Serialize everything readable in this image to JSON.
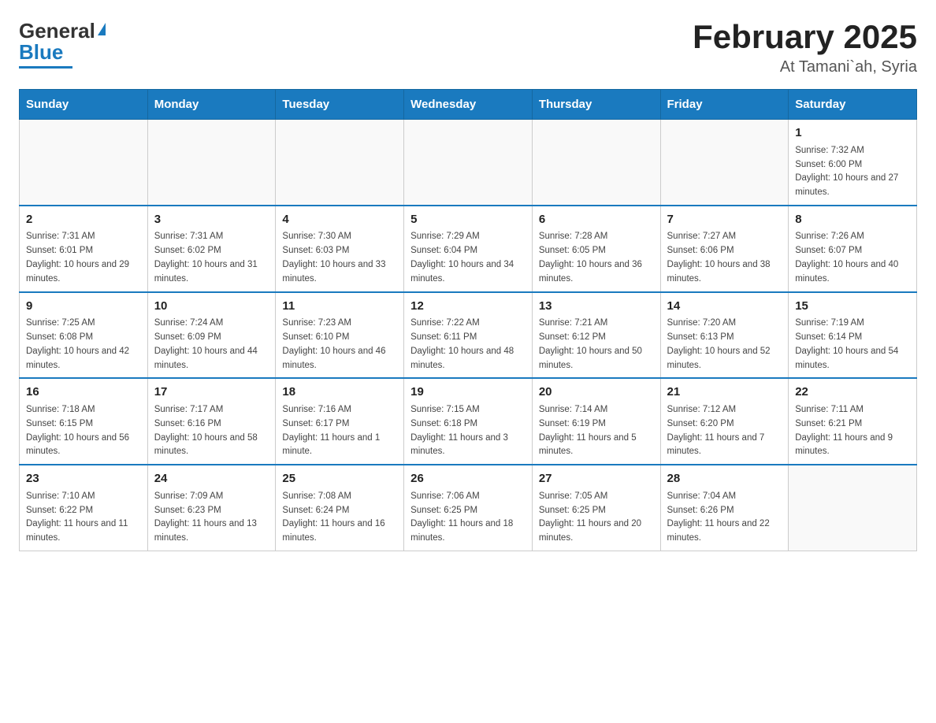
{
  "header": {
    "logo_general": "General",
    "logo_blue": "Blue",
    "title": "February 2025",
    "subtitle": "At Tamani`ah, Syria"
  },
  "days_of_week": [
    "Sunday",
    "Monday",
    "Tuesday",
    "Wednesday",
    "Thursday",
    "Friday",
    "Saturday"
  ],
  "weeks": [
    {
      "days": [
        {
          "num": "",
          "info": ""
        },
        {
          "num": "",
          "info": ""
        },
        {
          "num": "",
          "info": ""
        },
        {
          "num": "",
          "info": ""
        },
        {
          "num": "",
          "info": ""
        },
        {
          "num": "",
          "info": ""
        },
        {
          "num": "1",
          "info": "Sunrise: 7:32 AM\nSunset: 6:00 PM\nDaylight: 10 hours and 27 minutes."
        }
      ]
    },
    {
      "days": [
        {
          "num": "2",
          "info": "Sunrise: 7:31 AM\nSunset: 6:01 PM\nDaylight: 10 hours and 29 minutes."
        },
        {
          "num": "3",
          "info": "Sunrise: 7:31 AM\nSunset: 6:02 PM\nDaylight: 10 hours and 31 minutes."
        },
        {
          "num": "4",
          "info": "Sunrise: 7:30 AM\nSunset: 6:03 PM\nDaylight: 10 hours and 33 minutes."
        },
        {
          "num": "5",
          "info": "Sunrise: 7:29 AM\nSunset: 6:04 PM\nDaylight: 10 hours and 34 minutes."
        },
        {
          "num": "6",
          "info": "Sunrise: 7:28 AM\nSunset: 6:05 PM\nDaylight: 10 hours and 36 minutes."
        },
        {
          "num": "7",
          "info": "Sunrise: 7:27 AM\nSunset: 6:06 PM\nDaylight: 10 hours and 38 minutes."
        },
        {
          "num": "8",
          "info": "Sunrise: 7:26 AM\nSunset: 6:07 PM\nDaylight: 10 hours and 40 minutes."
        }
      ]
    },
    {
      "days": [
        {
          "num": "9",
          "info": "Sunrise: 7:25 AM\nSunset: 6:08 PM\nDaylight: 10 hours and 42 minutes."
        },
        {
          "num": "10",
          "info": "Sunrise: 7:24 AM\nSunset: 6:09 PM\nDaylight: 10 hours and 44 minutes."
        },
        {
          "num": "11",
          "info": "Sunrise: 7:23 AM\nSunset: 6:10 PM\nDaylight: 10 hours and 46 minutes."
        },
        {
          "num": "12",
          "info": "Sunrise: 7:22 AM\nSunset: 6:11 PM\nDaylight: 10 hours and 48 minutes."
        },
        {
          "num": "13",
          "info": "Sunrise: 7:21 AM\nSunset: 6:12 PM\nDaylight: 10 hours and 50 minutes."
        },
        {
          "num": "14",
          "info": "Sunrise: 7:20 AM\nSunset: 6:13 PM\nDaylight: 10 hours and 52 minutes."
        },
        {
          "num": "15",
          "info": "Sunrise: 7:19 AM\nSunset: 6:14 PM\nDaylight: 10 hours and 54 minutes."
        }
      ]
    },
    {
      "days": [
        {
          "num": "16",
          "info": "Sunrise: 7:18 AM\nSunset: 6:15 PM\nDaylight: 10 hours and 56 minutes."
        },
        {
          "num": "17",
          "info": "Sunrise: 7:17 AM\nSunset: 6:16 PM\nDaylight: 10 hours and 58 minutes."
        },
        {
          "num": "18",
          "info": "Sunrise: 7:16 AM\nSunset: 6:17 PM\nDaylight: 11 hours and 1 minute."
        },
        {
          "num": "19",
          "info": "Sunrise: 7:15 AM\nSunset: 6:18 PM\nDaylight: 11 hours and 3 minutes."
        },
        {
          "num": "20",
          "info": "Sunrise: 7:14 AM\nSunset: 6:19 PM\nDaylight: 11 hours and 5 minutes."
        },
        {
          "num": "21",
          "info": "Sunrise: 7:12 AM\nSunset: 6:20 PM\nDaylight: 11 hours and 7 minutes."
        },
        {
          "num": "22",
          "info": "Sunrise: 7:11 AM\nSunset: 6:21 PM\nDaylight: 11 hours and 9 minutes."
        }
      ]
    },
    {
      "days": [
        {
          "num": "23",
          "info": "Sunrise: 7:10 AM\nSunset: 6:22 PM\nDaylight: 11 hours and 11 minutes."
        },
        {
          "num": "24",
          "info": "Sunrise: 7:09 AM\nSunset: 6:23 PM\nDaylight: 11 hours and 13 minutes."
        },
        {
          "num": "25",
          "info": "Sunrise: 7:08 AM\nSunset: 6:24 PM\nDaylight: 11 hours and 16 minutes."
        },
        {
          "num": "26",
          "info": "Sunrise: 7:06 AM\nSunset: 6:25 PM\nDaylight: 11 hours and 18 minutes."
        },
        {
          "num": "27",
          "info": "Sunrise: 7:05 AM\nSunset: 6:25 PM\nDaylight: 11 hours and 20 minutes."
        },
        {
          "num": "28",
          "info": "Sunrise: 7:04 AM\nSunset: 6:26 PM\nDaylight: 11 hours and 22 minutes."
        },
        {
          "num": "",
          "info": ""
        }
      ]
    }
  ]
}
